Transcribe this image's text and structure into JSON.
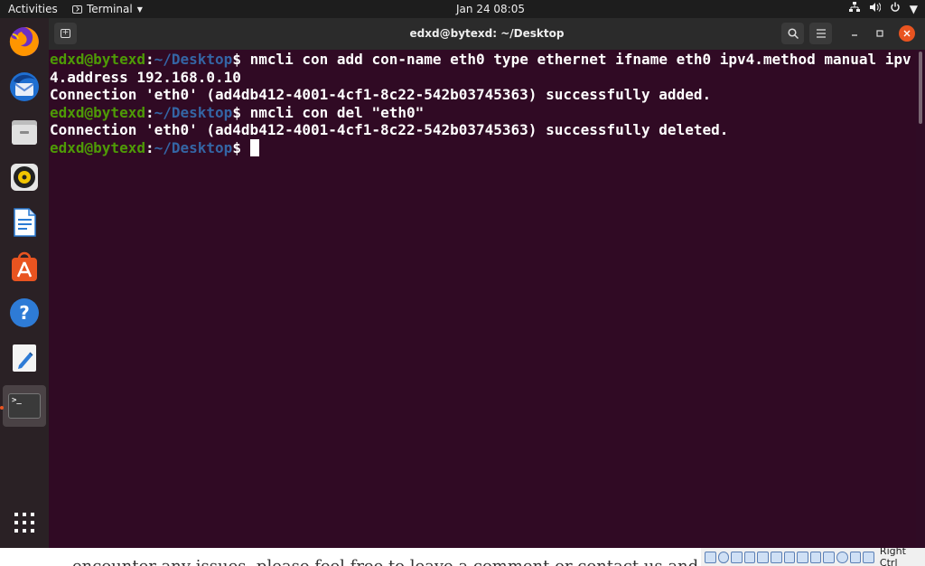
{
  "topbar": {
    "activities": "Activities",
    "app_name": "Terminal",
    "clock": "Jan 24  08:05"
  },
  "dock": {
    "items": [
      "firefox-icon",
      "thunderbird-icon",
      "files-icon",
      "rhythmbox-icon",
      "libreoffice-writer-icon",
      "software-icon",
      "help-icon",
      "text-editor-icon",
      "terminal-icon",
      "show-apps-icon"
    ],
    "help_glyph": "?",
    "terminal_glyph": ">_"
  },
  "window": {
    "title": "edxd@bytexd: ~/Desktop",
    "terminal": {
      "user": "edxd@bytexd",
      "path": "~/Desktop",
      "cmd1": "nmcli con add con-name eth0 type ethernet ifname eth0 ipv4.method manual ipv4.address 192.168.0.10",
      "out1": "Connection 'eth0' (ad4db412-4001-4cf1-8c22-542b03745363) successfully added.",
      "cmd2": "nmcli con del \"eth0\"",
      "out2": "Connection 'eth0' (ad4db412-4001-4cf1-8c22-542b03745363) successfully deleted."
    }
  },
  "statusbar": {
    "background_text": "encounter any issues, please feel free to leave a comment or contact us and we'll get",
    "host_key": "Right Ctrl"
  },
  "colors": {
    "terminal_bg": "#300a24",
    "prompt_user": "#4e9a06",
    "prompt_path": "#3465a4",
    "accent": "#e95420"
  }
}
